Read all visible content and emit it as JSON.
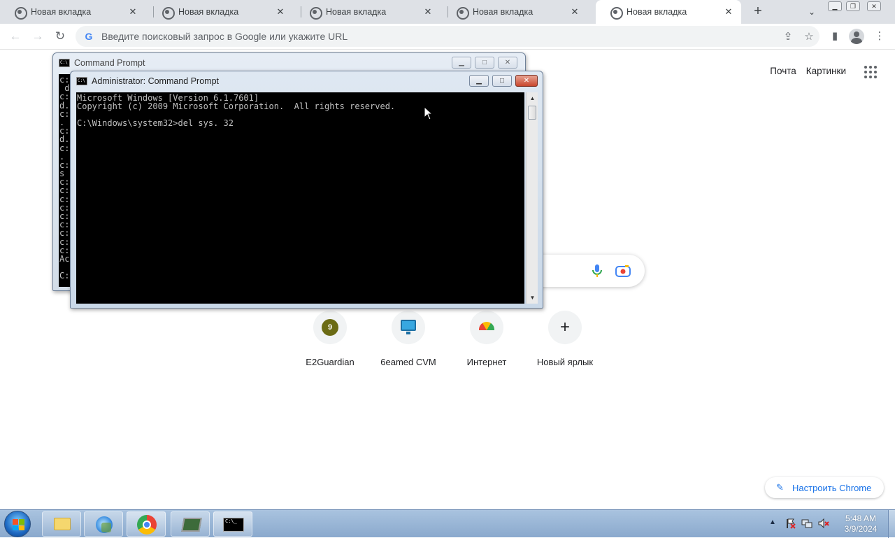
{
  "browser": {
    "tabs": [
      {
        "title": "Новая вкладка"
      },
      {
        "title": "Новая вкладка"
      },
      {
        "title": "Новая вкладка"
      },
      {
        "title": "Новая вкладка"
      },
      {
        "title": "Новая вкладка"
      }
    ],
    "active_tab_index": 4,
    "omnibox_placeholder": "Введите поисковый запрос в Google или укажите URL"
  },
  "newtab": {
    "links": {
      "mail": "Почта",
      "images": "Картинки"
    },
    "shortcuts": [
      {
        "label": "E2Guardian",
        "icon": "e2guardian-icon",
        "badge": "9"
      },
      {
        "label": "6eamed CVM",
        "icon": "monitor-icon"
      },
      {
        "label": "Интернет",
        "icon": "rainbow-icon"
      },
      {
        "label": "Новый ярлык",
        "icon": "plus-icon"
      }
    ],
    "customize_label": "Настроить Chrome"
  },
  "cmd_back": {
    "title": "Command Prompt",
    "visible_lines": [
      "c:",
      " d",
      "c:",
      "d.",
      "c:",
      ".",
      "c:",
      "d.",
      "c:",
      ".",
      "c:",
      "s",
      "c:",
      "c:",
      "c:",
      "c:",
      "c:",
      "c:",
      "c:",
      "c:",
      "c:",
      "Ac",
      "",
      "C:"
    ]
  },
  "cmd_front": {
    "title": "Administrator:  Command Prompt",
    "lines": [
      "Microsoft Windows [Version 6.1.7601]",
      "Copyright (c) 2009 Microsoft Corporation.  All rights reserved.",
      "",
      "C:\\Windows\\system32>del sys. 32"
    ]
  },
  "taskbar": {
    "clock_time": "5:48 AM",
    "clock_date": "3/9/2024"
  },
  "colors": {
    "chrome_tabstrip": "#dee1e6",
    "omnibox_bg": "#f1f3f4",
    "link_blue": "#1a73e8",
    "console_bg": "#000000",
    "console_text": "#c0c0c0",
    "taskbar": "#9bb6d6"
  }
}
